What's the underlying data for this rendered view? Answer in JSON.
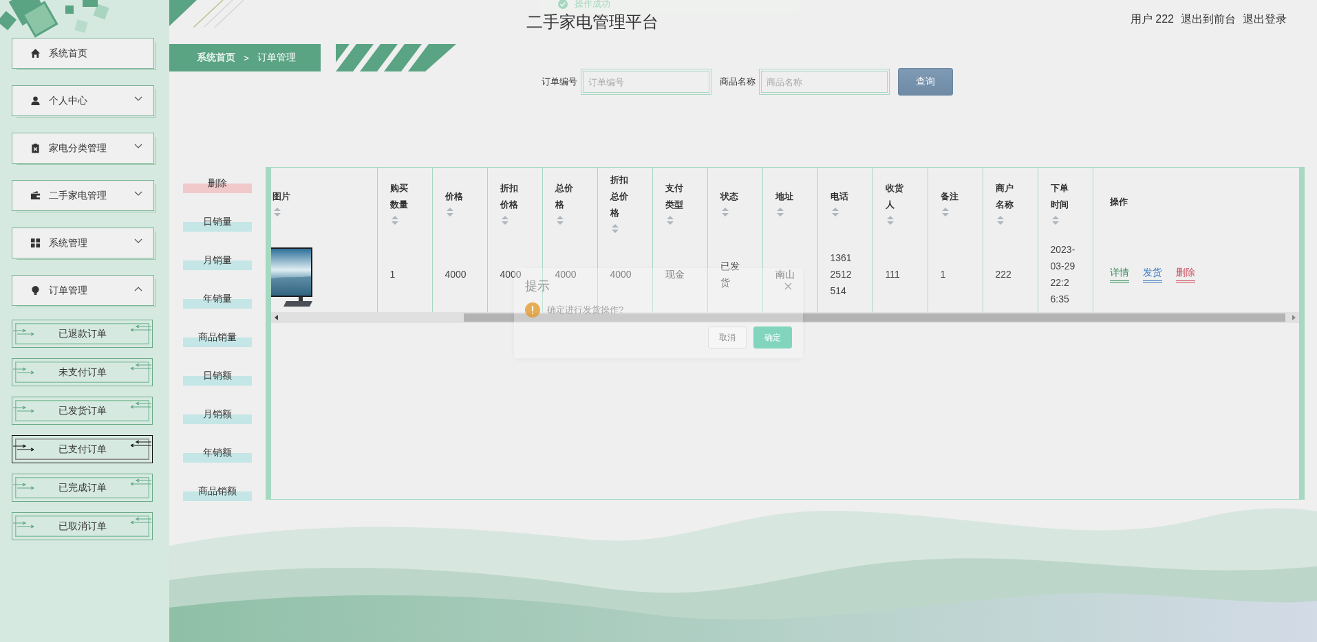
{
  "sidebar": {
    "menu": [
      {
        "label": "系统首页"
      },
      {
        "label": "个人中心",
        "expanded": false
      },
      {
        "label": "家电分类管理",
        "expanded": false
      },
      {
        "label": "二手家电管理",
        "expanded": false
      },
      {
        "label": "系统管理",
        "expanded": false
      },
      {
        "label": "订单管理",
        "expanded": true,
        "children": [
          {
            "label": "已退款订单",
            "selected": false
          },
          {
            "label": "未支付订单",
            "selected": false
          },
          {
            "label": "已发货订单",
            "selected": false
          },
          {
            "label": "已支付订单",
            "selected": true
          },
          {
            "label": "已完成订单",
            "selected": false
          },
          {
            "label": "已取消订单",
            "selected": false
          }
        ]
      }
    ]
  },
  "toast": {
    "message": "操作成功"
  },
  "header": {
    "title": "二手家电管理平台",
    "user": "用户 222",
    "links": [
      "退出到前台",
      "退出登录"
    ]
  },
  "breadcrumb": {
    "items": [
      "系统首页",
      "订单管理"
    ],
    "separator": ">"
  },
  "search": {
    "fields": [
      {
        "label": "订单编号",
        "placeholder": "订单编号"
      },
      {
        "label": "商品名称",
        "placeholder": "商品名称"
      }
    ],
    "button": "查询"
  },
  "side_actions": [
    {
      "label": "删除",
      "kind": "danger"
    },
    {
      "label": "日销量",
      "kind": "report"
    },
    {
      "label": "月销量",
      "kind": "report"
    },
    {
      "label": "年销量",
      "kind": "report"
    },
    {
      "label": "商品销量",
      "kind": "report"
    },
    {
      "label": "日销额",
      "kind": "report"
    },
    {
      "label": "月销额",
      "kind": "report"
    },
    {
      "label": "年销额",
      "kind": "report"
    },
    {
      "label": "商品销额",
      "kind": "report"
    }
  ],
  "table": {
    "columns": [
      {
        "label": "图片",
        "sortable": true
      },
      {
        "label": "购买数量",
        "kind": "text",
        "sortable": true
      },
      {
        "label": "价格",
        "kind": "text",
        "sortable": true
      },
      {
        "label": "折扣价格",
        "kind": "text",
        "sortable": true
      },
      {
        "label": "总价格",
        "kind": "text",
        "sortable": true
      },
      {
        "label": "折扣总价格",
        "kind": "text",
        "sortable": true
      },
      {
        "label": "支付类型",
        "kind": "text",
        "sortable": true
      },
      {
        "label": "状态",
        "kind": "text",
        "sortable": true
      },
      {
        "label": "地址",
        "kind": "text",
        "sortable": true
      },
      {
        "label": "电话",
        "kind": "text",
        "sortable": true
      },
      {
        "label": "收货人",
        "kind": "text",
        "sortable": true
      },
      {
        "label": "备注",
        "kind": "text",
        "sortable": true
      },
      {
        "label": "商户名称",
        "kind": "text",
        "sortable": true
      },
      {
        "label": "下单时间",
        "kind": "text",
        "sortable": true
      },
      {
        "label": "操作",
        "kind": "actions",
        "sortable": false
      }
    ],
    "rows": [
      {
        "cells": [
          {
            "kind": "picture"
          },
          {
            "kind": "text",
            "text": "1"
          },
          {
            "kind": "text",
            "text": "4000"
          },
          {
            "kind": "text",
            "text": "4000"
          },
          {
            "kind": "text",
            "text": "4000"
          },
          {
            "kind": "text",
            "text": "4000"
          },
          {
            "kind": "text",
            "text": "现金"
          },
          {
            "kind": "text",
            "text": "已发货"
          },
          {
            "kind": "text",
            "text": "南山"
          },
          {
            "kind": "text",
            "text": "13612512514"
          },
          {
            "kind": "text",
            "text": "111"
          },
          {
            "kind": "text",
            "text": "1"
          },
          {
            "kind": "text",
            "text": "222"
          },
          {
            "kind": "text",
            "text": "2023-03-29 22:26:35"
          },
          {
            "kind": "actions",
            "actions": [
              {
                "label": "详情",
                "color": "#3a8f62"
              },
              {
                "label": "发货",
                "color": "#3a78c2"
              },
              {
                "label": "删除",
                "color": "#cc4a5e"
              }
            ]
          }
        ]
      }
    ]
  },
  "dialog": {
    "title": "提示",
    "message": "确定进行发货操作?",
    "buttons": [
      {
        "label": "取消",
        "kind": "secondary"
      },
      {
        "label": "确定",
        "kind": "primary"
      }
    ]
  }
}
